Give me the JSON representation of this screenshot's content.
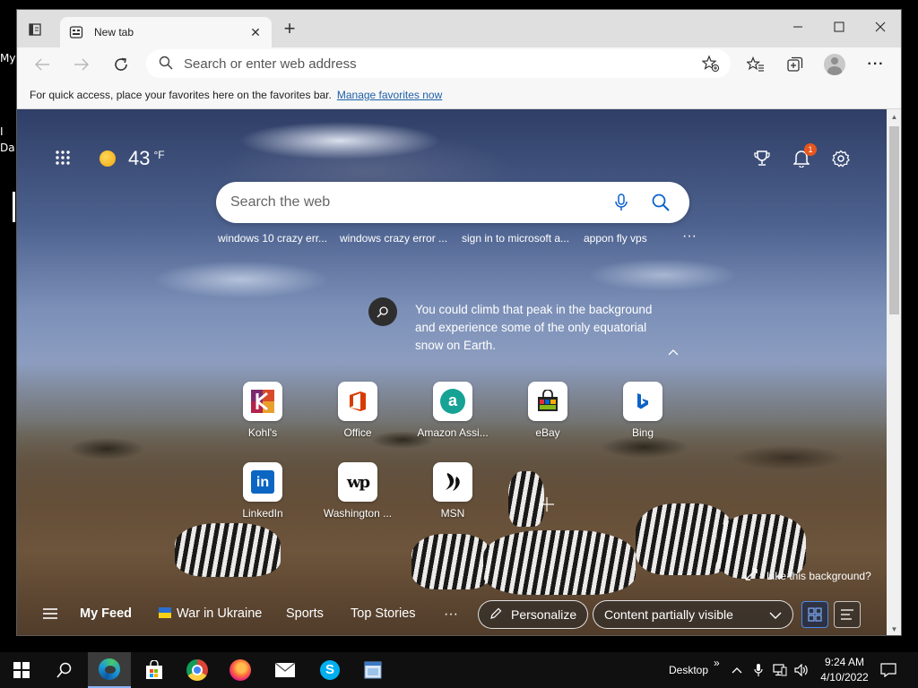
{
  "desktop": {
    "fragments": [
      "My",
      "I",
      "Da"
    ]
  },
  "browser": {
    "tab": {
      "title": "New tab"
    },
    "address_bar": {
      "placeholder": "Search or enter web address"
    },
    "favorites_bar": {
      "text": "For quick access, place your favorites here on the favorites bar.",
      "link": "Manage favorites now"
    }
  },
  "ntp": {
    "weather": {
      "temp": "43",
      "unit": "°F"
    },
    "notifications": {
      "count": "1"
    },
    "search": {
      "placeholder": "Search the web"
    },
    "trending": [
      "windows 10 crazy err...",
      "windows crazy error ...",
      "sign in to microsoft a...",
      "appon fly vps"
    ],
    "more_glyph": "···",
    "fact": "You could climb that peak in the background and experience some of the only equatorial snow on Earth.",
    "quick_links": [
      {
        "label": "Kohl's"
      },
      {
        "label": "Office"
      },
      {
        "label": "Amazon Assi..."
      },
      {
        "label": "eBay"
      },
      {
        "label": "Bing"
      },
      {
        "label": "LinkedIn",
        "icon_text": "in"
      },
      {
        "label": "Washington ...",
        "icon_text": "wp"
      },
      {
        "label": "MSN"
      }
    ],
    "like_background": "Like this background?",
    "feed": {
      "my_feed": "My Feed",
      "items": [
        "War in Ukraine",
        "Sports",
        "Top Stories"
      ],
      "more": "···",
      "personalize": "Personalize",
      "content_visibility": "Content partially visible"
    }
  },
  "taskbar": {
    "desktop_label": "Desktop",
    "overflow": "»",
    "time": "9:24 AM",
    "date": "4/10/2022"
  },
  "colors": {
    "accent": "#0a63c9",
    "badge": "#e8561d",
    "taskbar": "#101010"
  }
}
